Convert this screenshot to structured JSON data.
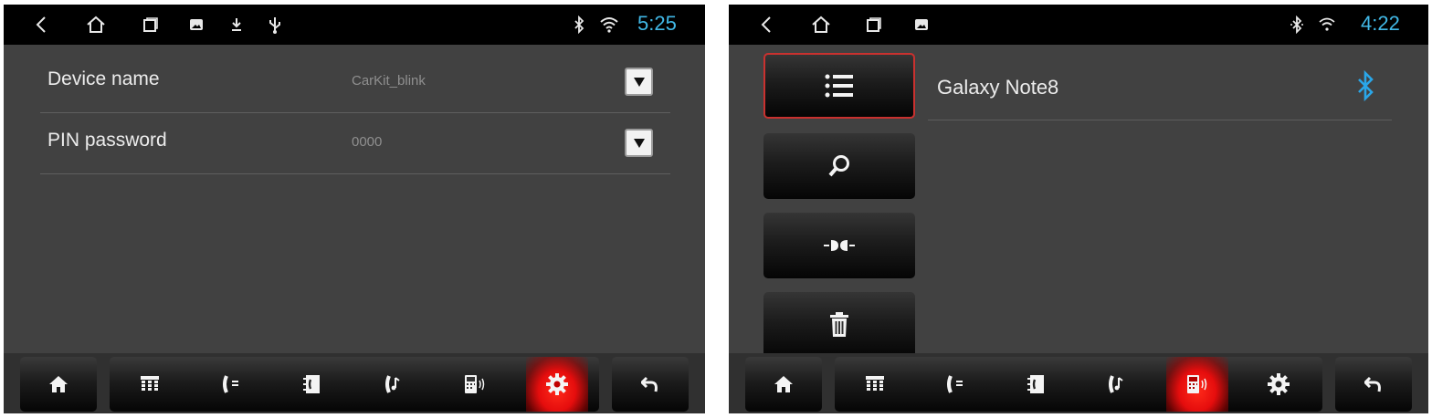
{
  "left_screen": {
    "statusbar": {
      "time": "5:25",
      "icons": [
        "back-icon",
        "home-outline-icon",
        "recent-apps-icon",
        "gallery-icon",
        "download-icon",
        "usb-icon",
        "bluetooth-icon",
        "wifi-icon"
      ]
    },
    "settings": [
      {
        "label": "Device name",
        "value": "CarKit_blink"
      },
      {
        "label": "PIN password",
        "value": "0000"
      }
    ],
    "bottom_nav": {
      "items": [
        "home-icon",
        "dialpad-icon",
        "call-log-icon",
        "contacts-icon",
        "bt-music-icon",
        "device-list-icon",
        "settings-gear-icon",
        "return-icon"
      ],
      "active": "settings-gear-icon"
    }
  },
  "right_screen": {
    "statusbar": {
      "time": "4:22",
      "icons": [
        "back-icon",
        "home-outline-icon",
        "recent-apps-icon",
        "gallery-icon",
        "bluetooth-icon",
        "wifi-icon"
      ]
    },
    "actions": [
      "paired-list-icon",
      "search-icon",
      "connect-icon",
      "delete-icon"
    ],
    "active_action": "paired-list-icon",
    "devices": [
      {
        "name": "Galaxy Note8"
      }
    ],
    "bottom_nav": {
      "items": [
        "home-icon",
        "dialpad-icon",
        "call-log-icon",
        "contacts-icon",
        "bt-music-icon",
        "device-list-icon",
        "settings-gear-icon",
        "return-icon"
      ],
      "active": "device-list-icon"
    }
  },
  "colors": {
    "clock": "#41b8e6",
    "active_nav": "#e50d0d",
    "active_border": "#c9312f",
    "bluetooth_connected": "#2aa6e8",
    "panel_bg": "#414141"
  }
}
